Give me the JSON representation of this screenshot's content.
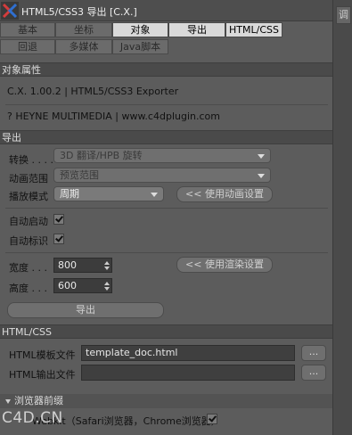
{
  "window": {
    "title": "HTML5/CSS3 导出 [C.X.]"
  },
  "tabs_row1": [
    "基本",
    "坐标",
    "对象",
    "导出",
    "HTML/CSS"
  ],
  "tabs_row2": [
    "回退",
    "多媒体",
    "Java脚本"
  ],
  "sections": {
    "object_props": "对象属性",
    "export": "导出",
    "html_css": "HTML/CSS"
  },
  "info": {
    "line1": "C.X. 1.00.2  |  HTML5/CSS3 Exporter",
    "line2": "? HEYNE MULTIMEDIA  |  www.c4dplugin.com"
  },
  "export": {
    "convert_label": "转换 . . . .",
    "convert_value": "3D 翻译/HPB 旋转",
    "anim_range_label": "动画范围",
    "anim_range_value": "预览范围",
    "play_mode_label": "播放模式",
    "play_mode_value": "周期",
    "use_anim_settings_btn": "<< 使用动画设置",
    "autostart_label": "自动启动",
    "autostart_checked": true,
    "auto_label_label": "自动标识",
    "auto_label_checked": true,
    "width_label": "宽度 . . .",
    "width_value": "800",
    "height_label": "高度 . . .",
    "height_value": "600",
    "use_render_settings_btn": "<< 使用渲染设置",
    "export_btn": "导出"
  },
  "htmlcss": {
    "template_label": "HTML模板文件",
    "template_value": "template_doc.html",
    "output_label": "HTML输出文件",
    "output_value": "",
    "browse_label": "..."
  },
  "browser_prefix": {
    "header": "浏览器前缀",
    "webkit_label": "Webkit（Safari浏览器，Chrome浏览器）",
    "webkit_checked": true
  },
  "right_dock": {
    "tab_label": "调"
  },
  "watermark": "C4D.CN",
  "colors": {
    "panel": "#5c5c5c",
    "section_header": "#4a4a4a",
    "active_tab": "#d9d9d9"
  }
}
